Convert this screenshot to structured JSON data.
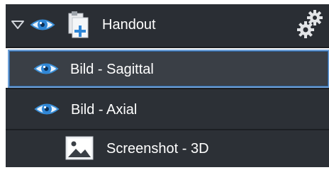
{
  "tree": {
    "group": {
      "label": "Handout",
      "expand_icon": "triangle-down-icon",
      "visibility_icon": "eye-icon",
      "type_icon": "document-add-icon",
      "settings_icon": "gears-icon"
    },
    "items": [
      {
        "label": "Bild - Sagittal",
        "icon": "eye-icon",
        "selected": true
      },
      {
        "label": "Bild - Axial",
        "icon": "eye-icon",
        "selected": false
      },
      {
        "label": "Screenshot - 3D",
        "icon": "image-icon",
        "selected": false
      }
    ]
  },
  "colors": {
    "row_bg": "#2c3036",
    "selected_bg": "#3a3f46",
    "selected_border": "#6ea0d8",
    "eye_blue": "#3a8fd8",
    "text": "#ffffff"
  }
}
